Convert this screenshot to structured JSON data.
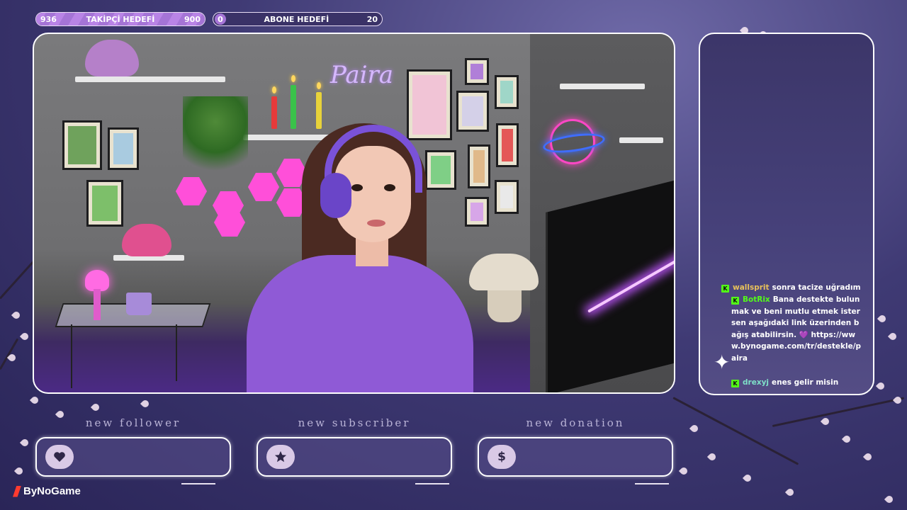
{
  "goals": {
    "follower": {
      "current": "936",
      "label": "TAKİPÇİ HEDEFİ",
      "target": "900",
      "progress": 1.0
    },
    "subscriber": {
      "current": "0",
      "label": "ABONE HEDEFİ",
      "target": "20",
      "progress": 0.0
    }
  },
  "scene": {
    "neon_sign": "Paira"
  },
  "chat": {
    "messages": [
      {
        "user": "wallsprit",
        "user_color": "#e8c25a",
        "text": "sonra tacize uğradım"
      },
      {
        "user": "BotRix",
        "user_color": "#53fc18",
        "text": "Bana destekte bulunmak ve beni mutlu etmek istersen aşağıdaki link üzerinden bağış atabilirsin. 💜 https://www.bynogame.com/tr/destekle/paira"
      },
      {
        "user": "drexyj",
        "user_color": "#7fe0c8",
        "text": "enes gelir misin"
      }
    ],
    "platform_badge": "K"
  },
  "alerts": {
    "follower": {
      "label": "new follower",
      "icon": "heart-icon"
    },
    "subscriber": {
      "label": "new subscriber",
      "icon": "star-icon"
    },
    "donation": {
      "label": "new donation",
      "icon": "dollar-icon",
      "symbol": "$"
    }
  },
  "brand": {
    "name": "ByNoGame",
    "color": "#ff3b2f"
  },
  "colors": {
    "accent": "#a574d6",
    "neon_pink": "#ff4fd9",
    "kick_green": "#53fc18"
  }
}
